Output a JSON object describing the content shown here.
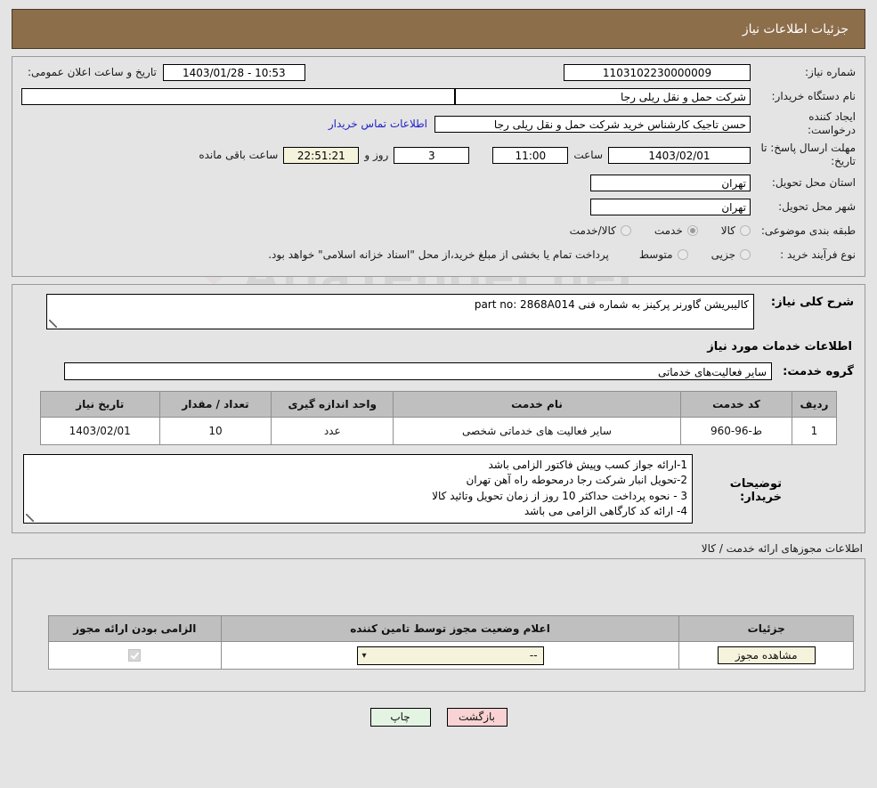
{
  "header": {
    "title": "جزئیات اطلاعات نیاز"
  },
  "watermark": {
    "text": "AriaTender.net"
  },
  "form": {
    "need_number_label": "شماره نیاز:",
    "need_number_value": "1103102230000009",
    "announce_label": "تاریخ و ساعت اعلان عمومی:",
    "announce_value": "10:53 - 1403/01/28",
    "buyer_org_label": "نام دستگاه خریدار:",
    "buyer_org_value": "شرکت حمل و نقل ریلی رجا",
    "creator_label": "ایجاد کننده درخواست:",
    "creator_value": "حسن تاجیک کارشناس خرید شرکت حمل و نقل ریلی رجا",
    "contact_link": "اطلاعات تماس خریدار",
    "deadline_label": "مهلت ارسال پاسخ: تا تاریخ:",
    "deadline_date": "1403/02/01",
    "deadline_hour_label": "ساعت",
    "deadline_time": "11:00",
    "remaining_days": "3",
    "remaining_days_label": "روز و",
    "remaining_time": "22:51:21",
    "remaining_suffix": "ساعت باقی مانده",
    "province_label": "استان محل تحویل:",
    "province_value": "تهران",
    "city_label": "شهر محل تحویل:",
    "city_value": "تهران",
    "category_label": "طبقه بندی موضوعی:",
    "category_options": [
      {
        "label": "کالا",
        "selected": false
      },
      {
        "label": "خدمت",
        "selected": true
      },
      {
        "label": "کالا/خدمت",
        "selected": false
      }
    ],
    "process_label": "نوع فرآیند خرید :",
    "process_options": [
      {
        "label": "جزیی",
        "selected": false
      },
      {
        "label": "متوسط",
        "selected": false
      }
    ],
    "payment_note": "پرداخت تمام یا بخشی از مبلغ خرید،از محل \"اسناد خزانه اسلامی\" خواهد بود."
  },
  "details": {
    "need_desc_label": "شرح کلی نیاز:",
    "need_desc_value": "کالیبریشن گاورنر پرکینز به شماره فنی part no: 2868A014",
    "services_section_title": "اطلاعات خدمات مورد نیاز",
    "service_group_label": "گروه خدمت:",
    "service_group_value": "سایر فعالیت‌های خدماتی",
    "table": {
      "columns": [
        "ردیف",
        "کد خدمت",
        "نام خدمت",
        "واحد اندازه گیری",
        "تعداد / مقدار",
        "تاریخ نیاز"
      ],
      "rows": [
        {
          "row_no": "1",
          "service_code": "ط-96-960",
          "service_name": "سایر فعالیت های خدماتی شخصی",
          "unit": "عدد",
          "quantity": "10",
          "need_date": "1403/02/01"
        }
      ]
    },
    "buyer_notes_label": "توضیحات خریدار:",
    "buyer_notes_value": "1-ارائه جواز کسب وپیش فاکتور الزامی باشد\n2-تحویل انبار شرکت رجا درمحوطه راه آهن تهران\n3 - نحوه پرداخت حداکثر 10 روز از زمان تحویل وتائید کالا\n4- ارائه کد کارگاهی الزامی می باشد"
  },
  "permits": {
    "caption": "اطلاعات مجوزهای ارائه خدمت / کالا",
    "columns": [
      "الزامی بودن ارائه مجوز",
      "اعلام وضعیت مجوز توسط تامین کننده",
      "جزئیات"
    ],
    "rows": [
      {
        "required_checked": true,
        "status_value": "--",
        "details_button": "مشاهده مجوز"
      }
    ]
  },
  "footer": {
    "print_label": "چاپ",
    "back_label": "بازگشت"
  }
}
